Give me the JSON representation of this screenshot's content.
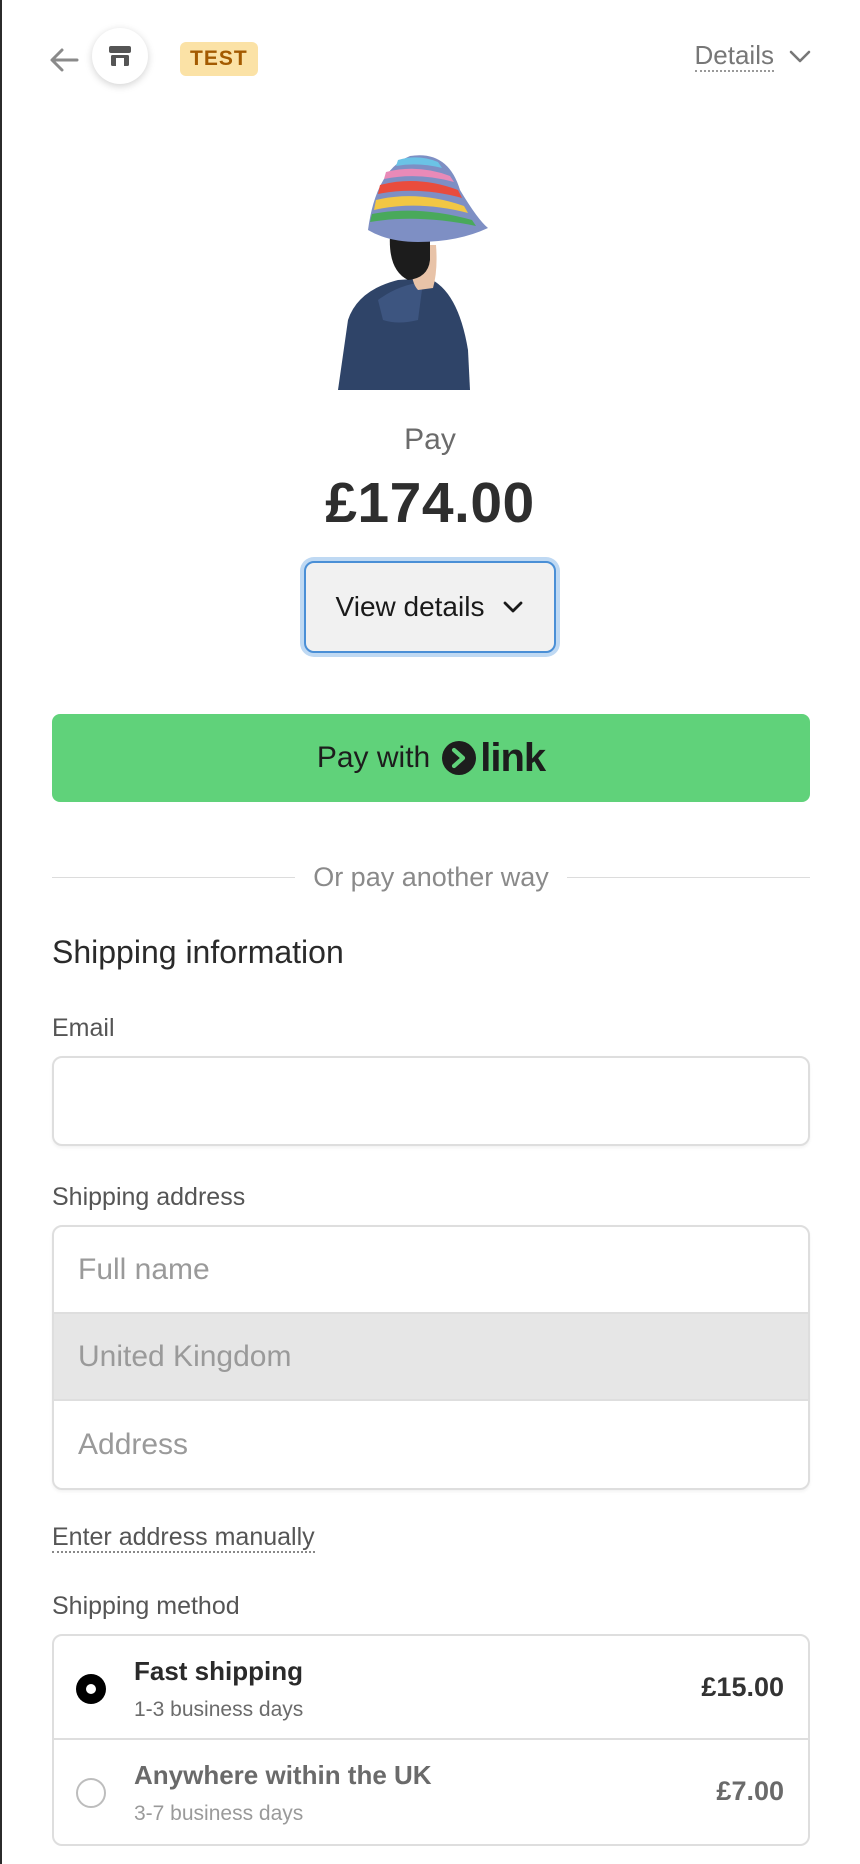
{
  "header": {
    "badge": "TEST",
    "details_label": "Details"
  },
  "product": {
    "pay_label": "Pay",
    "amount": "£174.00",
    "view_details_label": "View details"
  },
  "link_button": {
    "label": "Pay with",
    "brand": "link",
    "color": "#60d27a"
  },
  "divider_text": "Or pay another way",
  "shipping": {
    "section_title": "Shipping information",
    "email_label": "Email",
    "email_value": "",
    "address_label": "Shipping address",
    "full_name_placeholder": "Full name",
    "country_value": "United Kingdom",
    "address_placeholder": "Address",
    "manual_link": "Enter address manually",
    "method_label": "Shipping method",
    "methods": [
      {
        "name": "Fast shipping",
        "sub": "1-3 business days",
        "price": "£15.00",
        "selected": true
      },
      {
        "name": "Anywhere within the UK",
        "sub": "3-7 business days",
        "price": "£7.00",
        "selected": false
      }
    ]
  },
  "icons": {
    "back": "arrow-left-icon",
    "store": "store-icon",
    "chevron": "chevron-down-icon",
    "link_logo": "link-chevron-icon"
  }
}
